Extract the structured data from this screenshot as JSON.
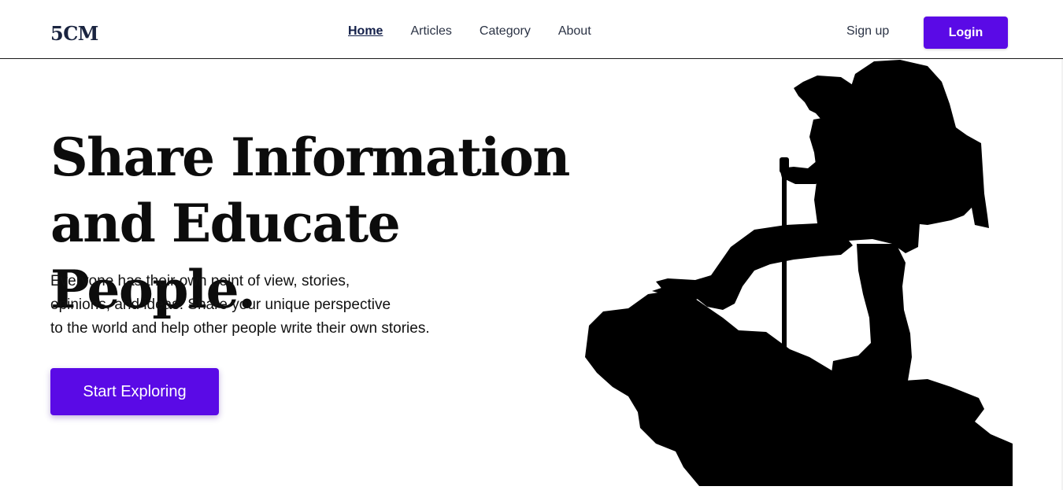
{
  "brand": {
    "logo": "5CM"
  },
  "nav": {
    "links": [
      {
        "label": "Home",
        "active": true
      },
      {
        "label": "Articles",
        "active": false
      },
      {
        "label": "Category",
        "active": false
      },
      {
        "label": "About",
        "active": false
      }
    ],
    "signup_label": "Sign up",
    "login_label": "Login"
  },
  "hero": {
    "title_line1": "Share Information",
    "title_line2": "and Educate People.",
    "description_lines": [
      "Everyone has their own point of view, stories,",
      "opinions, and ideas. Share your unique perspective",
      "to the world and help other people write their own stories."
    ],
    "cta_label": "Start Exploring",
    "illustration": "hiker-silhouette"
  },
  "colors": {
    "accent": "#5a0ae6",
    "text": "#0c0c0c",
    "nav_text": "#2b3345",
    "silhouette": "#000000"
  }
}
